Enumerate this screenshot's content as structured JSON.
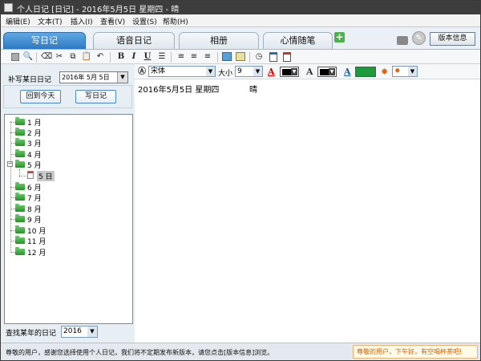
{
  "window": {
    "title": "个人日记 [日记] - 2016年5月5日 星期四 - 晴"
  },
  "menu": [
    {
      "label": "编辑(E)"
    },
    {
      "label": "文本(T)"
    },
    {
      "label": "插入(I)"
    },
    {
      "label": "查看(V)"
    },
    {
      "label": "设置(S)"
    },
    {
      "label": "帮助(H)"
    }
  ],
  "tabs": [
    {
      "label": "写日记",
      "active": true
    },
    {
      "label": "语音日记",
      "active": false
    },
    {
      "label": "相册",
      "active": false
    },
    {
      "label": "心情随笔",
      "active": false
    }
  ],
  "header": {
    "add_symbol": "+",
    "version_button": "版本信息"
  },
  "toolbar": {
    "bold": "B",
    "italic": "I",
    "underline": "U"
  },
  "left": {
    "backfill_label": "补写某日日记",
    "date_value": "2016年 5月 5日",
    "today_button": "回到今天",
    "write_button": "写日记",
    "find_label": "查找某年的日记",
    "year_value": "2016"
  },
  "tree": {
    "months": [
      {
        "label": "1 月"
      },
      {
        "label": "2 月"
      },
      {
        "label": "3 月"
      },
      {
        "label": "4 月"
      },
      {
        "label": "5 月"
      },
      {
        "label": "6 月"
      },
      {
        "label": "7 月"
      },
      {
        "label": "8 月"
      },
      {
        "label": "9 月"
      },
      {
        "label": "10 月"
      },
      {
        "label": "11 月"
      },
      {
        "label": "12 月"
      }
    ],
    "day": {
      "label": "5 日"
    }
  },
  "format": {
    "font": "宋体",
    "size_label": "大小",
    "size_value": "9",
    "text_a": "A"
  },
  "editor": {
    "date_line": "2016年5月5日 星期四",
    "weather": "晴"
  },
  "status": {
    "text": "尊敬的用户，感谢您选择使用个人日记，我们将不定期发布新版本，请您点击[版本信息]浏览。",
    "greeting": "尊敬的用户，下午好，有空喝杯茶吧!"
  },
  "colors": {
    "active_tab": "#2f79c2",
    "folder": "#2c8f2c",
    "greeting_text": "#d06000"
  }
}
